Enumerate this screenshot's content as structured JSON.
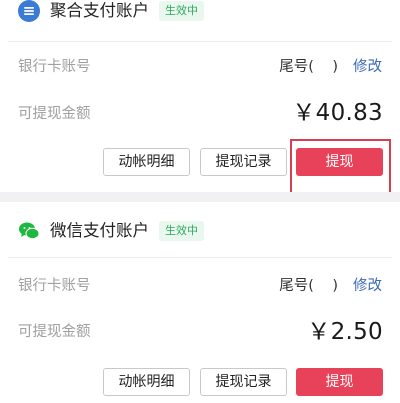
{
  "colors": {
    "accent": "#e8425a",
    "link": "#3d6bb5",
    "status_bg": "#eaf7ee",
    "status_text": "#2ea860",
    "icon_blue": "#3a7bd5",
    "icon_green": "#1fb83e",
    "highlight": "#d4404f"
  },
  "accounts": [
    {
      "icon": "aggregate-pay-icon",
      "title": "聚合支付账户",
      "status": "生效中",
      "bank_label": "银行卡账号",
      "bank_tail": "尾号(    )",
      "edit": "修改",
      "amount_label": "可提现金额",
      "amount": "￥40.83",
      "buttons": {
        "detail": "动帐明细",
        "records": "提现记录",
        "withdraw": "提现"
      }
    },
    {
      "icon": "wechat-icon",
      "title": "微信支付账户",
      "status": "生效中",
      "bank_label": "银行卡账号",
      "bank_tail": "尾号(    )",
      "edit": "修改",
      "amount_label": "可提现金额",
      "amount": "￥2.50",
      "buttons": {
        "detail": "动帐明细",
        "records": "提现记录",
        "withdraw": "提现"
      }
    }
  ]
}
